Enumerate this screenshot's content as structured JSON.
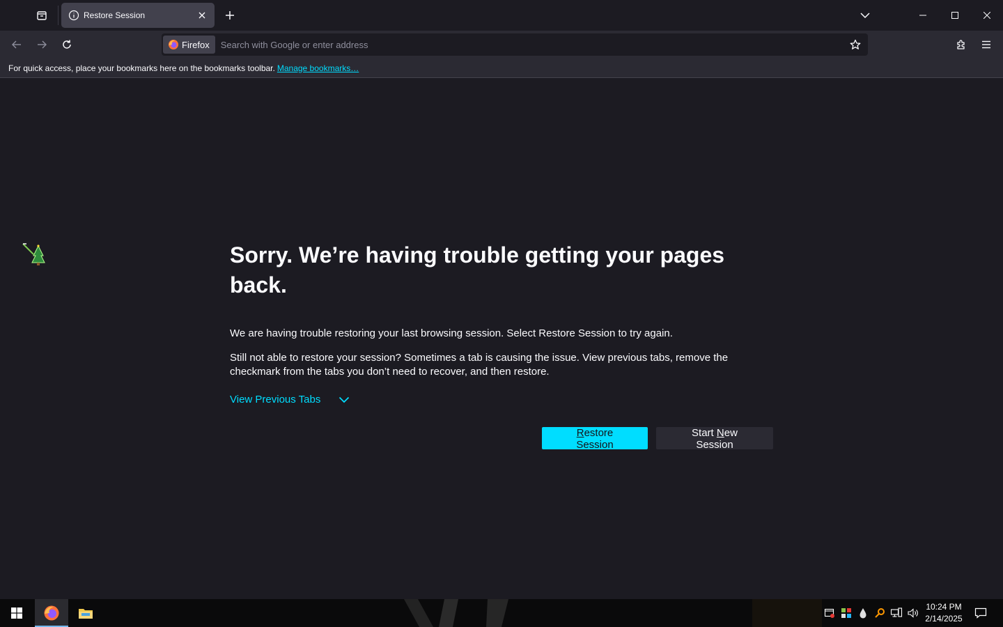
{
  "tabs": [
    {
      "title": "Restore Session",
      "active": true
    }
  ],
  "urlbar": {
    "identity_label": "Firefox",
    "placeholder": "Search with Google or enter address",
    "value": ""
  },
  "bookmarks_bar": {
    "message": "For quick access, place your bookmarks here on the bookmarks toolbar.",
    "manage_link": "Manage bookmarks…"
  },
  "error_page": {
    "title": "Sorry. We’re having trouble getting your pages back.",
    "paragraph_1": "We are having trouble restoring your last browsing session. Select Restore Session to try again.",
    "paragraph_2": "Still not able to restore your session? Sometimes a tab is causing the issue. View previous tabs, remove the checkmark from the tabs you don’t need to recover, and then restore.",
    "view_previous_tabs": "View Previous Tabs",
    "restore_button": {
      "access_key": "R",
      "rest": "estore Session"
    },
    "new_session_button": {
      "before": "Start ",
      "access_key": "N",
      "after": "ew Session"
    }
  },
  "taskbar": {
    "pinned": [
      "firefox-icon",
      "file-explorer-icon"
    ],
    "tray_icons": [
      "security-icon",
      "gpu-icon",
      "drop-icon",
      "search-tool-icon",
      "network-icon",
      "volume-icon"
    ],
    "clock_time": "10:24 PM",
    "clock_date": "2/14/2025"
  },
  "colors": {
    "accent": "#00ddff",
    "background": "#1c1b22",
    "toolbar": "#2b2a33",
    "tab_active": "#42414d"
  }
}
